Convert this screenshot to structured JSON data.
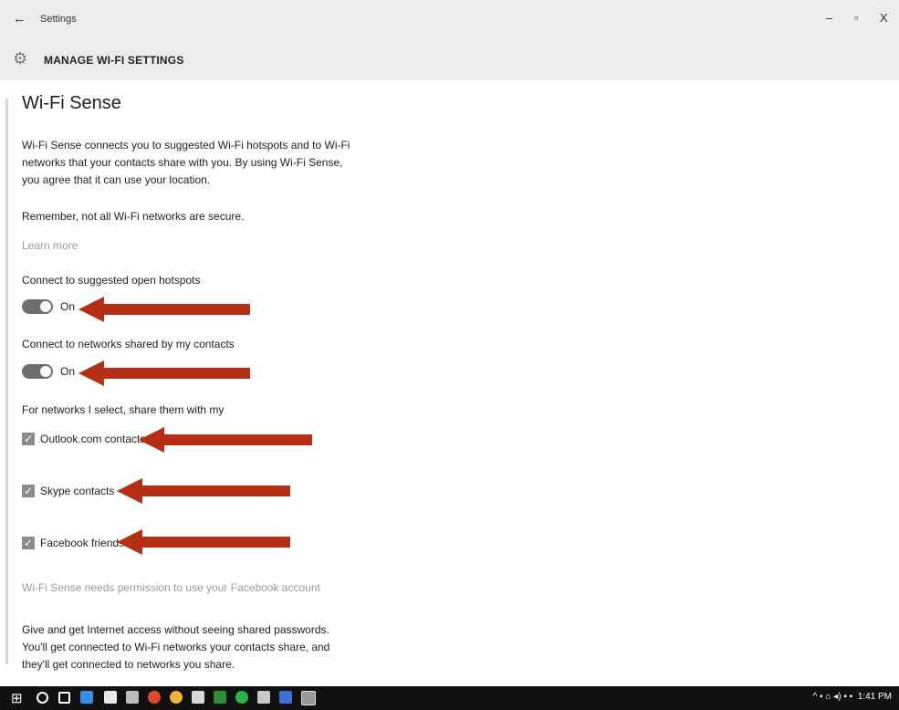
{
  "window": {
    "title": "Settings",
    "back_glyph": "←",
    "minimize": "–",
    "maximize": "▫",
    "close": "X"
  },
  "header": {
    "title": "MANAGE WI-FI SETTINGS",
    "icon": "gear-icon"
  },
  "section": {
    "title": "Wi-Fi Sense",
    "description_lines": [
      "Wi-Fi Sense connects you to suggested Wi-Fi hotspots and to Wi-Fi",
      "networks that your contacts share with you. By using Wi-Fi Sense,",
      "you agree that it can use your location."
    ],
    "remember": "Remember, not all Wi-Fi networks are secure.",
    "learn_more": "Learn more"
  },
  "toggles": [
    {
      "label": "Connect to suggested open hotspots",
      "state": "On",
      "checked": true
    },
    {
      "label": "Connect to networks shared by my contacts",
      "state": "On",
      "checked": true
    }
  ],
  "share": {
    "heading": "For networks I select, share them with my",
    "items": [
      {
        "label": "Outlook.com contacts",
        "checked": true
      },
      {
        "label": "Skype contacts",
        "checked": true
      },
      {
        "label": "Facebook friends",
        "checked": true
      }
    ]
  },
  "facebook_note": "Wi-Fi Sense needs permission to use your Facebook account",
  "footer_lines": [
    "Give and get Internet access without seeing shared passwords.",
    "You'll get connected to Wi-Fi networks your contacts share, and",
    "they'll get connected to networks you share."
  ],
  "taskbar": {
    "clock": "1:41 PM",
    "tray_glyphs": "^  ▪  ⌂  ◂)  ▪  ▪"
  },
  "colors": {
    "arrow": "#b52e16",
    "toggle_on": "#6e6e6e",
    "checkbox": "#8b8b8b",
    "titlebar": "#ededed"
  }
}
